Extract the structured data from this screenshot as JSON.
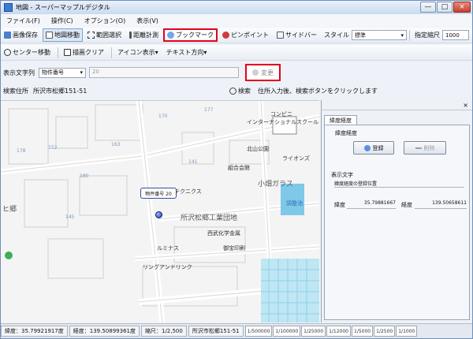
{
  "window": {
    "title": "地図 - スーパーマップルデジタル",
    "minimize": "—",
    "maximize": "□",
    "close": "×"
  },
  "menu": [
    "ファイル(F)",
    "操作(C)",
    "オプション(O)",
    "表示(V)"
  ],
  "toolbar1": {
    "save_image": "画像保存",
    "map_move": "地図移動",
    "range_select": "範囲選択",
    "distance": "距離計測",
    "bookmark": "ブックマーク",
    "pinpoint": "ピンポイント",
    "sidebar": "サイドバー",
    "style_label": "スタイル",
    "style_value": "標準",
    "scale_label": "指定縮尺",
    "scale_value": "1000"
  },
  "toolbar2": {
    "center_move": "センター移動",
    "clear_drawing": "描画クリア",
    "icon_display": "アイコン表示",
    "text_direction": "テキスト方向"
  },
  "search": {
    "label": "表示文字列",
    "field_value": "物件番号",
    "input_value": "20",
    "change_button": "変更"
  },
  "address": {
    "label": "検索住所",
    "value": "所沢市松郷151-51",
    "search_button": "検索",
    "hint": "住所入力後、検索ボタンをクリックします"
  },
  "map": {
    "labels": {
      "convenience": "コンビニ",
      "school": "インターナショナルスクール",
      "park": "北山公園",
      "lions": "ライオンズ",
      "union": "組合会館",
      "glass": "小畑ガラス",
      "pond": "調整池",
      "technics": "テクニクス",
      "industrial": "所沢松郷工業団地",
      "chemical": "西武化学金属",
      "luminous": "ルミナス",
      "press": "御宝印刷",
      "ring": "リングアンドリンク",
      "district": "ヒ郷"
    },
    "numbers": [
      "152",
      "170",
      "177",
      "163",
      "180",
      "145",
      "178",
      "141"
    ],
    "callout": "物件番号 20"
  },
  "panel": {
    "close": "×",
    "tab": "緯度経度",
    "group": "緯度経度",
    "register": "登録",
    "delete": "削除",
    "display_text_label": "表示文字",
    "display_text_value": "緯度経度の登録位置",
    "lat_label": "緯度",
    "lat_value": "35.79881667",
    "lon_label": "経度",
    "lon_value": "139.50658611"
  },
  "status": {
    "latitude": "緯度：35.79921917度",
    "longitude": "経度：139.50899361度",
    "scale": "縮尺：1/2,500",
    "location": "所沢市松郷151-51",
    "scales": [
      "1/500000",
      "1/100000",
      "1/25000",
      "1/12000",
      "1/5000",
      "1/2500",
      "1/1000"
    ]
  },
  "colors": {
    "highlight": "#e3001b",
    "callout_border": "#2c4f9e",
    "pond": "#7ec8e8"
  }
}
